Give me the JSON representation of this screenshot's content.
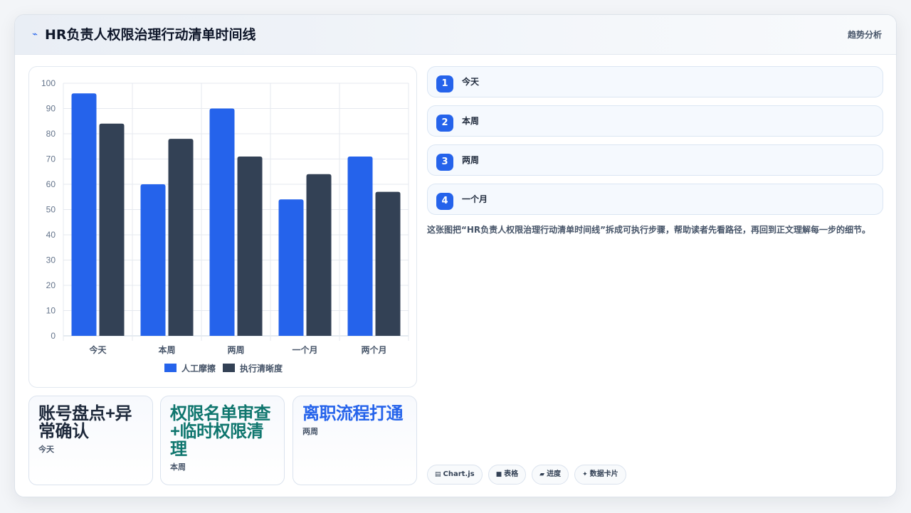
{
  "header": {
    "icon": "trend-icon",
    "title": "HR负责人权限治理行动清单时间线",
    "link_label": "趋势分析"
  },
  "chart_data": {
    "type": "bar",
    "categories": [
      "今天",
      "本周",
      "两周",
      "一个月",
      "两个月"
    ],
    "series": [
      {
        "name": "人工摩擦",
        "values": [
          96,
          60,
          90,
          54,
          71
        ],
        "color": "#2563eb"
      },
      {
        "name": "执行清晰度",
        "values": [
          84,
          78,
          71,
          64,
          57
        ],
        "color": "#334155"
      }
    ],
    "ylim": [
      0,
      100
    ],
    "yticks": [
      0,
      10,
      20,
      30,
      40,
      50,
      60,
      70,
      80,
      90,
      100
    ],
    "grid": true,
    "legend": "bottom"
  },
  "stat_cards": [
    {
      "title": "账号盘点+异常确认",
      "sub": "今天",
      "color": "#1e293b"
    },
    {
      "title": "权限名单审查+临时权限清理",
      "sub": "本周",
      "color": "#0f766e"
    },
    {
      "title": "离职流程打通",
      "sub": "两周",
      "color": "#2563eb"
    }
  ],
  "steps": [
    {
      "num": "1",
      "label": "今天"
    },
    {
      "num": "2",
      "label": "本周"
    },
    {
      "num": "3",
      "label": "两周"
    },
    {
      "num": "4",
      "label": "一个月"
    }
  ],
  "description": "这张图把“HR负责人权限治理行动清单时间线”拆成可执行步骤，帮助读者先看路径，再回到正文理解每一步的细节。",
  "tags": [
    {
      "icon": "chart-icon",
      "glyph": "▤",
      "label": "Chart.js"
    },
    {
      "icon": "table-icon",
      "glyph": "■",
      "label": "表格"
    },
    {
      "icon": "progress-icon",
      "glyph": "▰",
      "label": "进度"
    },
    {
      "icon": "sparkle-icon",
      "glyph": "✦",
      "label": "数据卡片"
    }
  ]
}
